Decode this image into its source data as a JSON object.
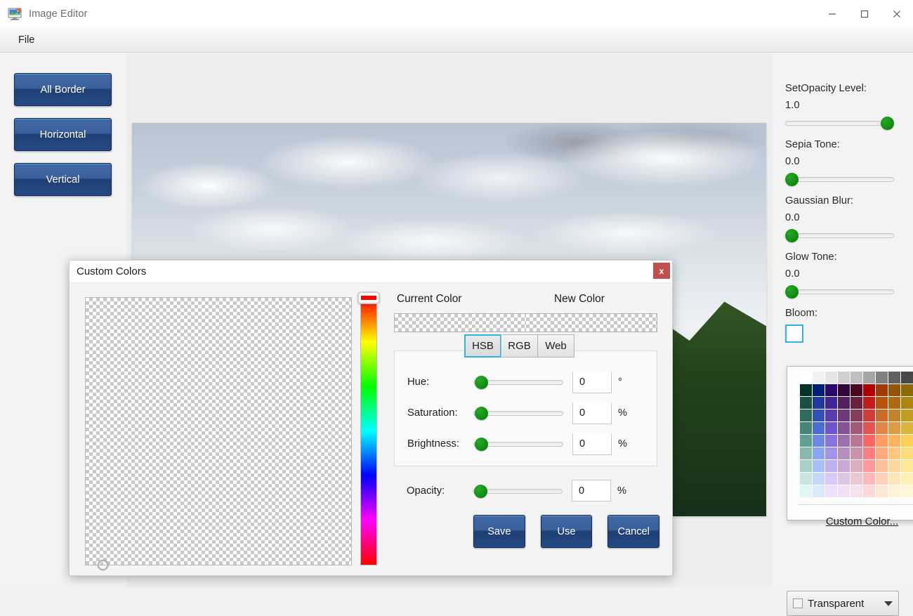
{
  "window": {
    "title": "Image Editor",
    "icon": "image-editor-icon",
    "controls": {
      "minimize": "—",
      "maximize": "▢",
      "close": "✕"
    }
  },
  "menubar": {
    "items": [
      {
        "label": "File"
      }
    ]
  },
  "sidebar": {
    "buttons": [
      {
        "label": "All Border",
        "name": "all-border"
      },
      {
        "label": "Horizontal",
        "name": "horizontal"
      },
      {
        "label": "Vertical",
        "name": "vertical"
      }
    ]
  },
  "effects": {
    "items": [
      {
        "label": "SetOpacity Level:",
        "value": "1.0",
        "thumb_pct": 100
      },
      {
        "label": "Sepia Tone:",
        "value": "0.0",
        "thumb_pct": 0
      },
      {
        "label": "Gaussian Blur:",
        "value": "0.0",
        "thumb_pct": 0
      },
      {
        "label": "Glow Tone:",
        "value": "0.0",
        "thumb_pct": 0
      }
    ],
    "bloom": {
      "label": "Bloom:",
      "swatch_color": "#ffffff",
      "focus_color": "#2fb3e8"
    }
  },
  "color_picker": {
    "custom_color_link": "Custom Color...",
    "combo": {
      "value": "Transparent",
      "swatch_color": "#f4f4f4"
    },
    "palette_rows": [
      [
        "#ffffff",
        "#f2f2f2",
        "#e6e6e6",
        "#d0d0d0",
        "#bfbfbf",
        "#a6a6a6",
        "#808080",
        "#616161",
        "#484848",
        "#303030"
      ],
      [
        "#04332c",
        "#001f77",
        "#2b0a70",
        "#32063a",
        "#4d0620",
        "#b00000",
        "#a03a07",
        "#95540a",
        "#8c6b06",
        "#8a9106"
      ],
      [
        "#1a4f44",
        "#203a9c",
        "#42249a",
        "#54205e",
        "#6a213a",
        "#c41a1a",
        "#b8520f",
        "#b06a14",
        "#ab8510",
        "#a8b013"
      ],
      [
        "#2f6b5e",
        "#3350b5",
        "#5c3bb5",
        "#6d3a7a",
        "#8a3d58",
        "#d63b3b",
        "#cc6a2a",
        "#c4822b",
        "#c39c22",
        "#c0cc26"
      ],
      [
        "#47857a",
        "#4b6cd0",
        "#6f54cf",
        "#855396",
        "#a45a76",
        "#e55252",
        "#e08548",
        "#dc9b44",
        "#d9b53c",
        "#dbe23f"
      ],
      [
        "#60a094",
        "#6a8ae2",
        "#8a72e0",
        "#9d6fac",
        "#b97791",
        "#ff6464",
        "#ff9c63",
        "#ffb35c",
        "#ffce55",
        "#ffff55"
      ],
      [
        "#86b8ae",
        "#8aa6ef",
        "#a591ec",
        "#b58fc0",
        "#cb93a9",
        "#ff7d7d",
        "#ffab7f",
        "#ffc67c",
        "#ffdb79",
        "#ffff79"
      ],
      [
        "#a9cfc8",
        "#a9bef5",
        "#bfb0f3",
        "#c9aad3",
        "#dbaebf",
        "#ff9999",
        "#ffbf9b",
        "#ffd79a",
        "#ffe79a",
        "#ffff9a"
      ],
      [
        "#c8e5e0",
        "#c5d6f9",
        "#d6cbf8",
        "#ddc6e4",
        "#e9c8d3",
        "#ffb8b8",
        "#ffd2b7",
        "#ffe5b8",
        "#fff0b8",
        "#ffffb8"
      ],
      [
        "#dcf7f5",
        "#dbe9fd",
        "#eae2fd",
        "#f2e0f6",
        "#f7e1ea",
        "#ffd8d8",
        "#ffe7d6",
        "#fff2d8",
        "#fff8d8",
        "#ffffd8"
      ]
    ]
  },
  "dialog": {
    "title": "Custom Colors",
    "close_label": "x",
    "close_color": "#c0504d",
    "current_color_label": "Current Color",
    "new_color_label": "New Color",
    "current_color": "transparent",
    "new_color": "transparent",
    "tabs": [
      {
        "label": "HSB",
        "active": true
      },
      {
        "label": "RGB",
        "active": false
      },
      {
        "label": "Web",
        "active": false
      }
    ],
    "sliders": [
      {
        "label": "Hue:",
        "value": "0",
        "unit": "°",
        "thumb_pct": 0
      },
      {
        "label": "Saturation:",
        "value": "0",
        "unit": "%",
        "thumb_pct": 0
      },
      {
        "label": "Brightness:",
        "value": "0",
        "unit": "%",
        "thumb_pct": 0
      }
    ],
    "opacity": {
      "label": "Opacity:",
      "value": "0",
      "unit": "%",
      "thumb_pct": 0
    },
    "buttons": [
      {
        "label": "Save"
      },
      {
        "label": "Use"
      },
      {
        "label": "Cancel"
      }
    ]
  }
}
